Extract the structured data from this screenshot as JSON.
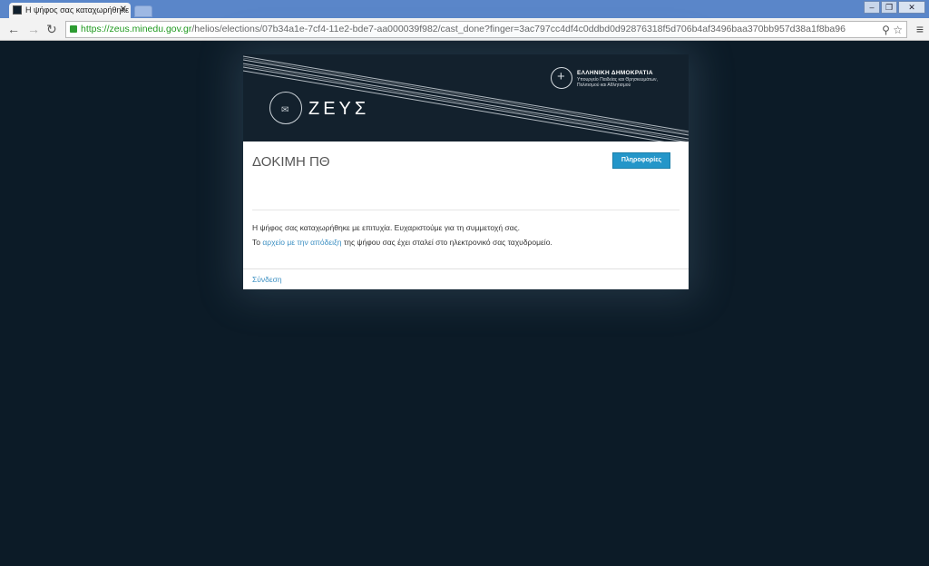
{
  "browser": {
    "tab_title": "Η ψήφος σας καταχωρήθηκε",
    "url_scheme": "https://",
    "url_host": "zeus.minedu.gov.gr",
    "url_path": "/helios/elections/07b34a1e-7cf4-11e2-bde7-aa000039f982/cast_done?finger=3ac797cc4df4c0ddbd0d92876318f5d706b4af3496baa370bb957d38a1f8ba96"
  },
  "banner": {
    "app_name": "ΖΕΥΣ",
    "gov_title": "ΕΛΛΗΝΙΚΗ ΔΗΜΟΚΡΑΤΙΑ",
    "gov_subtitle": "Υπουργείο Παιδείας και Θρησκευμάτων, Πολιτισμού και Αθλητισμού"
  },
  "page": {
    "title": "ΔΟΚΙΜΗ ΠΘ",
    "info_button": "Πληροφορίες",
    "message_line1": "Η ψήφος σας καταχωρήθηκε με επιτυχία. Ευχαριστούμε για τη συμμετοχή σας.",
    "message_line2_prefix": "Το ",
    "message_line2_link": "αρχείο με την απόδειξη",
    "message_line2_suffix": " της ψήφου σας έχει σταλεί στο ηλεκτρονικό σας ταχυδρομείο.",
    "footer_link": "Σύνδεση"
  },
  "colors": {
    "page_background": "#0c1b27",
    "banner_background": "#13212d",
    "accent": "#2496c9",
    "link": "#3b8fc2"
  }
}
